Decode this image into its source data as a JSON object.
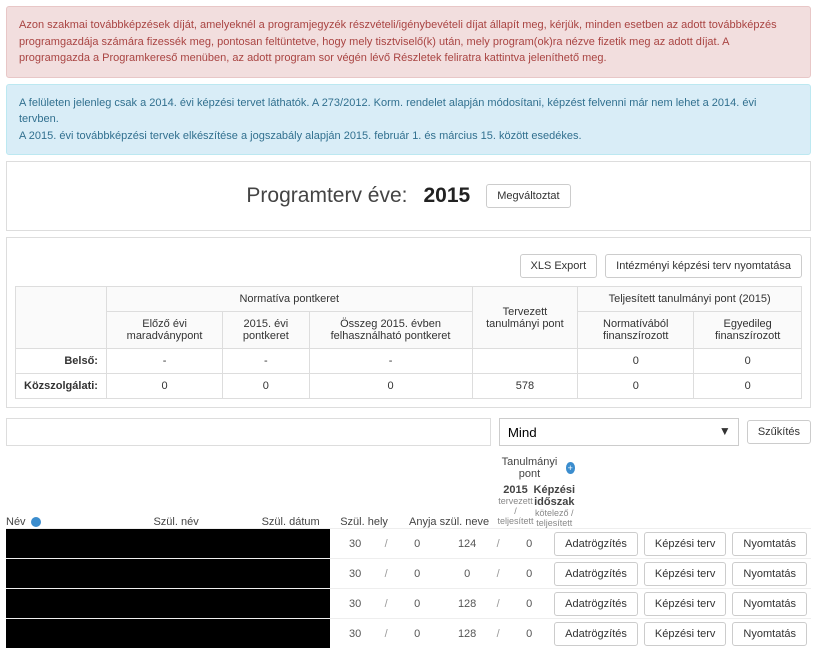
{
  "alerts": {
    "pink": "Azon szakmai továbbképzések díját, amelyeknél a programjegyzék részvételi/igénybevételi díjat állapít meg, kérjük, minden esetben az adott továbbképzés programgazdája számára fizessék meg, pontosan feltüntetve, hogy mely tisztviselő(k) után, mely program(ok)ra nézve fizetik meg az adott díjat. A programgazda a Programkereső menüben, az adott program sor végén lévő Részletek feliratra kattintva jeleníthető meg.",
    "blue_line1": "A felületen jelenleg csak a 2014. évi képzési tervet láthatók. A 273/2012. Korm. rendelet alapján módosítani, képzést felvenni már nem lehet a 2014. évi tervben.",
    "blue_line2": "A 2015. évi továbbképzési tervek elkészítése a jogszabály alapján 2015. február 1. és március 15. között esedékes."
  },
  "year": {
    "label": "Programterv éve:",
    "value": "2015",
    "change_btn": "Megváltoztat"
  },
  "toolbar": {
    "xls": "XLS Export",
    "print": "Intézményi képzési terv nyomtatása"
  },
  "summary": {
    "head": {
      "normativa": "Normatíva pontkeret",
      "prev": "Előző évi maradványpont",
      "year_quota": "2015. évi pontkeret",
      "total": "Összeg 2015. évben felhasználható pontkeret",
      "planned": "Tervezett tanulmányi pont",
      "done": "Teljesített tanulmányi pont (2015)",
      "norm_fin": "Normatívából finanszírozott",
      "ind_fin": "Egyedileg finanszírozott"
    },
    "rows": [
      {
        "label": "Belső:",
        "prev": "-",
        "yq": "-",
        "tot": "-",
        "plan": "",
        "nf": "0",
        "ef": "0"
      },
      {
        "label": "Közszolgálati:",
        "prev": "0",
        "yq": "0",
        "tot": "0",
        "plan": "578",
        "nf": "0",
        "ef": "0"
      }
    ]
  },
  "filter": {
    "placeholder": "",
    "select_value": "Mind",
    "narrow_btn": "Szűkítés"
  },
  "list_head": {
    "name": "Név",
    "birth_name": "Szül. név",
    "birth_date": "Szül. dátum",
    "birth_place": "Szül. hely",
    "mother_name": "Anyja szül. neve",
    "points_group": "Tanulmányi pont",
    "col_2015": "2015",
    "col_period": "Képzési időszak",
    "sub_tk": "tervezett / teljesített",
    "sub_kk": "kötelező / teljesített"
  },
  "row_buttons": {
    "record": "Adatrögzítés",
    "plan": "Képzési terv",
    "print": "Nyomtatás"
  },
  "rows": [
    {
      "p1": "30",
      "p2": "0",
      "p3": "124",
      "p4": "0"
    },
    {
      "p1": "30",
      "p2": "0",
      "p3": "0",
      "p4": "0"
    },
    {
      "p1": "30",
      "p2": "0",
      "p3": "128",
      "p4": "0"
    },
    {
      "p1": "30",
      "p2": "0",
      "p3": "128",
      "p4": "0"
    }
  ]
}
